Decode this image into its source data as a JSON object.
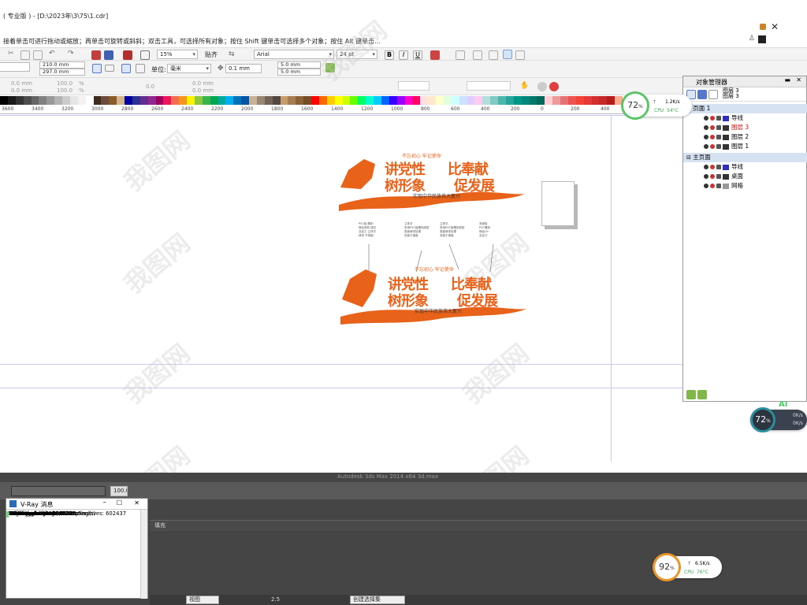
{
  "window": {
    "title": "( 专业版 ) - [D:\\2023年\\3\\75\\1.cdr]",
    "hint": "接着单击可进行拖动或缩放；再单击可旋转或斜斜；双击工具，可选择所有对象；按住 Shift 键单击可选择多个对象；按住 Alt 键单击..."
  },
  "toolbar": {
    "zoom": "15%",
    "snap_label": "贴齐",
    "font_name": "Arial",
    "font_size": "24 pt"
  },
  "propbar": {
    "width": "210.0 mm",
    "height": "297.0 mm",
    "unit_label": "单位:",
    "unit": "毫米",
    "nudge": "0.1 mm",
    "dup_x": "5.0 mm",
    "dup_y": "5.0 mm",
    "pos_x": "0.0 mm",
    "pos_y": "0.0 mm",
    "scale_x": "100.0",
    "scale_y": "100.0",
    "pct": "%",
    "angle": "0.0",
    "size_x": "0.0 mm",
    "size_y": "0.0 mm"
  },
  "ruler": {
    "ticks": [
      "3600",
      "3400",
      "3200",
      "3000",
      "2800",
      "2600",
      "2400",
      "2200",
      "2000",
      "1800",
      "1600",
      "1400",
      "1200",
      "1000",
      "800",
      "600",
      "400",
      "200",
      "0",
      "200",
      "400"
    ]
  },
  "palette": [
    "#000000",
    "#1a1a1a",
    "#333333",
    "#4d4d4d",
    "#666666",
    "#808080",
    "#999999",
    "#b3b3b3",
    "#cccccc",
    "#e6e6e6",
    "#f2f2f2",
    "#ffffff",
    "#3f2b1c",
    "#6d4c3d",
    "#8b5a2b",
    "#d2b48c",
    "#0000a0",
    "#2e3192",
    "#662d91",
    "#92278f",
    "#9e005d",
    "#ed145b",
    "#f26c4f",
    "#f7941d",
    "#fff200",
    "#8dc63f",
    "#39b54a",
    "#00a651",
    "#00a99d",
    "#00aeef",
    "#0072bc",
    "#0054a6",
    "#c7b299",
    "#998675",
    "#736357",
    "#534741",
    "#c69c6d",
    "#a67c52",
    "#8c6239",
    "#754c24",
    "#ff0000",
    "#ff6600",
    "#ffcc00",
    "#ffff00",
    "#ccff00",
    "#66ff00",
    "#00ff66",
    "#00ffcc",
    "#00ccff",
    "#0066ff",
    "#3300ff",
    "#9900ff",
    "#ff00cc",
    "#ff0066",
    "#ffe0e0",
    "#ffe8cc",
    "#ffffcc",
    "#e0ffe0",
    "#ccffff",
    "#cce0ff",
    "#e0ccff",
    "#ffccf0",
    "#b2dfdb",
    "#80cbc4",
    "#4db6ac",
    "#26a69a",
    "#009688",
    "#00897b",
    "#00796b",
    "#00695c",
    "#ffcdd2",
    "#ef9a9a",
    "#e57373",
    "#ef5350",
    "#f44336",
    "#e53935",
    "#d32f2f",
    "#c62828",
    "#b71c1c",
    "#ffab91"
  ],
  "design": {
    "top_banner": {
      "header": "不忘初心  牢记使命",
      "line1_left": "讲党性",
      "line1_right": "比奉献",
      "line2_left": "树形象",
      "line2_right": "促发展",
      "sub": "实现中华民族伟大复兴"
    },
    "bottom_banner": {
      "header": "不忘初心  牢记使命",
      "line1_left": "讲党性",
      "line1_right": "比奉献",
      "line2_left": "树形象",
      "line2_right": "促发展",
      "sub": "实现中华民族伟大复兴"
    },
    "middle_blocks": [
      "PVC板 雕刻\n喷绘背胶 镂空\n亚克力 立体字\n烤漆 不锈钢",
      "立体字\n采用PVC板雕刻成型\n表面烤漆处理\n安装于墙面",
      "立体字\n采用PVC板雕刻成型\n表面烤漆处理\n安装于墙面",
      "背景板\nPVC雕刻\n喷绘UV\n亚克力"
    ]
  },
  "object_manager": {
    "title": "对象管理器",
    "layer_tabs": [
      "图层 3",
      "图层 3"
    ],
    "page1_label": "页面 1",
    "page1_layers": [
      {
        "name": "导线",
        "color": "#3030c0",
        "highlight": false
      },
      {
        "name": "图层 3",
        "color": "#333333",
        "highlight": true
      },
      {
        "name": "图层 2",
        "color": "#333333",
        "highlight": false
      },
      {
        "name": "图层 1",
        "color": "#333333",
        "highlight": false
      }
    ],
    "master_label": "主页面",
    "master_layers": [
      {
        "name": "导线",
        "color": "#3030c0"
      },
      {
        "name": "桌面",
        "color": "#333333"
      },
      {
        "name": "网格",
        "color": "#999999"
      }
    ]
  },
  "monitors": [
    {
      "percent": "72",
      "unit": "%",
      "speed": "1.2K/s",
      "cpu_label": "CPU",
      "cpu": "54°C",
      "ring": "#5ec46a",
      "cpu_color": "#3aa850"
    },
    {
      "percent": "72",
      "unit": "%",
      "up": "0K/s",
      "down": "0K/s",
      "badge": "AI"
    },
    {
      "percent": "92",
      "unit": "%",
      "speed": "6.5K/s",
      "cpu_label": "CPU",
      "cpu": "76°C",
      "ring": "#e8962a",
      "cpu_color": "#3aa850"
    }
  ],
  "max": {
    "caption": "Autodesk 3ds Max 2014 x64          3d.max",
    "spinner_value": "100.0",
    "tab_label": "填充",
    "view_combo": "视图",
    "selection_combo": "创建选择集",
    "field_value": "2.5"
  },
  "vray": {
    "title": "V-Ray 消息",
    "lines": [
      "Reflection rays: 5098042",
      "Refraction rays: 0",
      "Unshaded rays: 0",
      "Number of intersectable primitives: 602437",
      "SD triangles: 600845",
      "MB triangles: 0",
      "Static primitives: 1592",
      "Moving primitives: 0",
      "Infinite primitives: 0",
      "Region rendering: 412.8 s",
      "Total frame time: 426.2 s",
      "Total sequence time: 426.5 s"
    ],
    "warning": "warning: 0 error(s), 2 warning(s)"
  }
}
